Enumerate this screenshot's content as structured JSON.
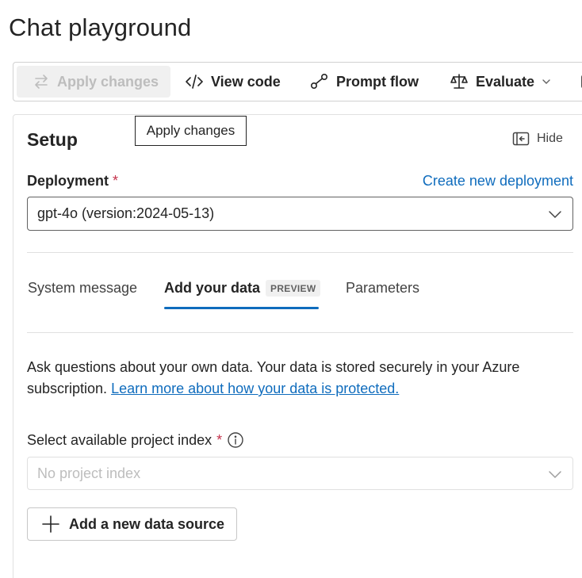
{
  "page": {
    "title": "Chat playground"
  },
  "toolbar": {
    "apply_label": "Apply changes",
    "view_code_label": "View code",
    "prompt_flow_label": "Prompt flow",
    "evaluate_label": "Evaluate"
  },
  "tooltip": {
    "text": "Apply changes"
  },
  "setup": {
    "title": "Setup",
    "hide_label": "Hide",
    "deployment_label": "Deployment",
    "required_mark": "*",
    "create_link": "Create new deployment",
    "deployment_value": "gpt-4o (version:2024-05-13)"
  },
  "tabs": {
    "system": "System message",
    "data": "Add your data",
    "data_badge": "PREVIEW",
    "params": "Parameters"
  },
  "data_section": {
    "description": "Ask questions about your own data. Your data is stored securely in your Azure subscription.",
    "learn_more": "Learn more about how your data is protected.",
    "index_label": "Select available project index",
    "index_required": "*",
    "index_placeholder": "No project index",
    "add_source_label": "Add a new data source"
  },
  "colors": {
    "accent": "#0f6cbd",
    "required": "#c4314b"
  }
}
